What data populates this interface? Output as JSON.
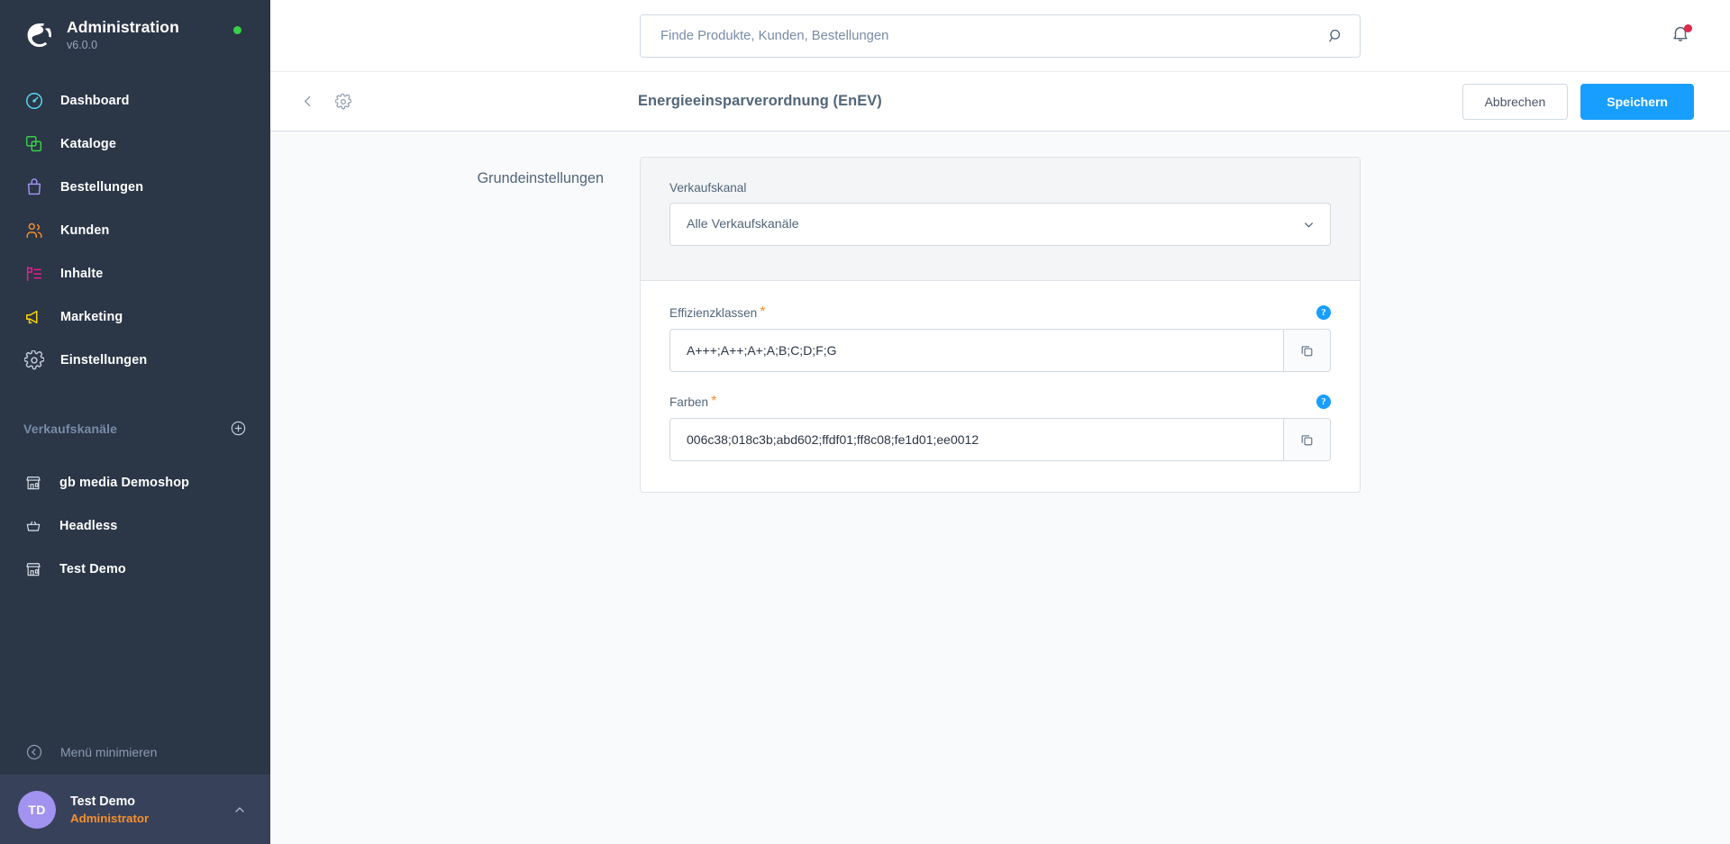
{
  "sidebar": {
    "brand": {
      "title": "Administration",
      "version": "v6.0.0",
      "logo_icon": "shopware-logo-icon",
      "status_icon": "status-online-dot"
    },
    "nav": [
      {
        "label": "Dashboard",
        "icon": "dashboard-icon",
        "color": "#57d9f3"
      },
      {
        "label": "Kataloge",
        "icon": "catalog-icon",
        "color": "#37d046"
      },
      {
        "label": "Bestellungen",
        "icon": "orders-bag-icon",
        "color": "#a093ee"
      },
      {
        "label": "Kunden",
        "icon": "customers-icon",
        "color": "#f88f2b"
      },
      {
        "label": "Inhalte",
        "icon": "content-icon",
        "color": "#ed1c8d"
      },
      {
        "label": "Marketing",
        "icon": "megaphone-icon",
        "color": "#ffd700"
      },
      {
        "label": "Einstellungen",
        "icon": "gear-icon",
        "color": "#c4ccd8"
      }
    ],
    "sales_channels": {
      "heading": "Verkaufskanäle",
      "add_icon": "plus-circle-icon",
      "items": [
        {
          "label": "gb media Demoshop",
          "icon": "storefront-icon"
        },
        {
          "label": "Headless",
          "icon": "basket-icon"
        },
        {
          "label": "Test Demo",
          "icon": "storefront-icon"
        }
      ]
    },
    "minimize": {
      "label": "Menü minimieren",
      "icon": "collapse-left-icon"
    },
    "user": {
      "initials": "TD",
      "name": "Test Demo",
      "role": "Administrator",
      "caret_icon": "chevron-up-icon"
    }
  },
  "topbar": {
    "search": {
      "placeholder": "Finde Produkte, Kunden, Bestellungen",
      "value": "",
      "icon": "search-icon"
    },
    "notifications": {
      "icon": "bell-icon",
      "has_unread": true,
      "badge_color": "#de294c"
    }
  },
  "pagehead": {
    "back_icon": "chevron-left-icon",
    "settings_icon": "gear-icon",
    "title": "Energieeinsparverordnung (EnEV)",
    "cancel_label": "Abbrechen",
    "save_label": "Speichern",
    "primary_color": "#189eff"
  },
  "content": {
    "section_label": "Grundeinstellungen",
    "sales_channel_field": {
      "label": "Verkaufskanal",
      "value": "Alle Verkaufskanäle",
      "caret_icon": "chevron-down-icon"
    },
    "fields": [
      {
        "label": "Effizienzklassen",
        "required_marker": "*",
        "value": "A+++;A++;A+;A;B;C;D;F;G",
        "help_icon": "help-question-icon",
        "help_glyph": "?",
        "copy_icon": "copy-icon"
      },
      {
        "label": "Farben",
        "required_marker": "*",
        "value": "006c38;018c3b;abd602;ffdf01;ff8c08;fe1d01;ee0012",
        "help_icon": "help-question-icon",
        "help_glyph": "?",
        "copy_icon": "copy-icon"
      }
    ]
  }
}
